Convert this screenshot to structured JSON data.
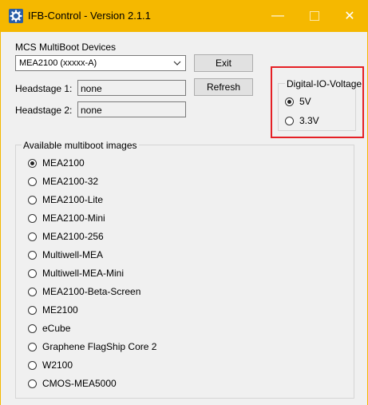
{
  "window": {
    "title": "IFB-Control - Version 2.1.1",
    "controls": {
      "minimize": "—",
      "close": "✕"
    },
    "accent": "#f5b800"
  },
  "devices": {
    "label": "MCS MultiBoot Devices",
    "selected": "MEA2100 (xxxxx-A)",
    "exit_label": "Exit",
    "refresh_label": "Refresh"
  },
  "headstages": [
    {
      "label": "Headstage 1:",
      "value": "none"
    },
    {
      "label": "Headstage 2:",
      "value": "none"
    }
  ],
  "voltage": {
    "title": "Digital-IO-Voltage",
    "options": [
      {
        "label": "5V",
        "selected": true
      },
      {
        "label": "3.3V",
        "selected": false
      }
    ],
    "highlight_color": "#e52025"
  },
  "images": {
    "title": "Available multiboot images",
    "options": [
      {
        "label": "MEA2100",
        "selected": true
      },
      {
        "label": "MEA2100-32",
        "selected": false
      },
      {
        "label": "MEA2100-Lite",
        "selected": false
      },
      {
        "label": "MEA2100-Mini",
        "selected": false
      },
      {
        "label": "MEA2100-256",
        "selected": false
      },
      {
        "label": "Multiwell-MEA",
        "selected": false
      },
      {
        "label": "Multiwell-MEA-Mini",
        "selected": false
      },
      {
        "label": "MEA2100-Beta-Screen",
        "selected": false
      },
      {
        "label": "ME2100",
        "selected": false
      },
      {
        "label": "eCube",
        "selected": false
      },
      {
        "label": "Graphene FlagShip Core 2",
        "selected": false
      },
      {
        "label": "W2100",
        "selected": false
      },
      {
        "label": "CMOS-MEA5000",
        "selected": false
      }
    ]
  }
}
